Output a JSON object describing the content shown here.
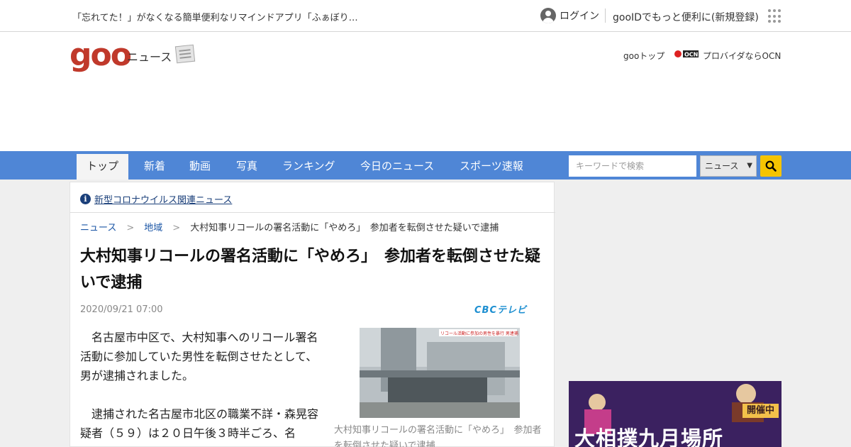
{
  "topbar": {
    "promo": "「忘れてた！」がなくなる簡単便利なリマインドアプリ「ふぁぼり…",
    "login": "ログイン",
    "register": "gooIDでもっと便利に(新規登録)"
  },
  "header": {
    "logo": "goo",
    "section": "ニュース",
    "goo_top": "gooトップ",
    "ocn": "プロバイダならOCN"
  },
  "nav": {
    "items": [
      "トップ",
      "新着",
      "動画",
      "写真",
      "ランキング",
      "今日のニュース",
      "スポーツ速報"
    ],
    "search_placeholder": "キーワードで検索",
    "search_scope": "ニュース"
  },
  "notice": {
    "text": "新型コロナウイルス関連ニュース"
  },
  "breadcrumb": [
    "ニュース",
    "地域",
    "大村知事リコールの署名活動に「やめろ」　参加者を転倒させた疑いで逮捕"
  ],
  "article": {
    "title": "大村知事リコールの署名活動に「やめろ」　参加者を転倒させた疑いで逮捕",
    "date": "2020/09/21 07:00",
    "source": "CBCテレビ",
    "paragraphs": [
      "名古屋市中区で、大村知事へのリコール署名活動に参加していた男性を転倒させたとして、男が逮捕されました。",
      "逮捕された名古屋市北区の職業不詳・森晃容疑者（５９）は２０日午後３時半ごろ、名"
    ],
    "photo_overlay": "リコール活動に参加の男性を暴行 男逮捕",
    "caption": "大村知事リコールの署名活動に「やめろ」　参加者を転倒させた疑いで逮捕"
  },
  "ad": {
    "badge": "開催中",
    "title": "大相撲九月場所"
  }
}
